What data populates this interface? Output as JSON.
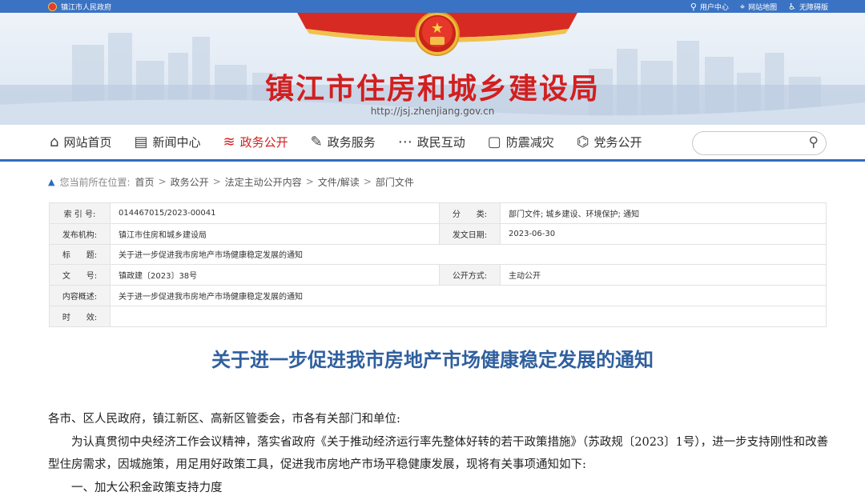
{
  "topbar": {
    "gov_name": "镇江市人民政府",
    "links": [
      "用户中心",
      "网站地图",
      "无障碍版"
    ]
  },
  "banner": {
    "title": "镇江市住房和城乡建设局",
    "url": "http://jsj.zhenjiang.gov.cn"
  },
  "nav": {
    "items": [
      {
        "label": "网站首页",
        "icon": "home-icon"
      },
      {
        "label": "新闻中心",
        "icon": "news-icon"
      },
      {
        "label": "政务公开",
        "icon": "layers-icon"
      },
      {
        "label": "政务服务",
        "icon": "document-icon"
      },
      {
        "label": "政民互动",
        "icon": "chat-icon"
      },
      {
        "label": "防震减灾",
        "icon": "square-icon"
      },
      {
        "label": "党务公开",
        "icon": "party-icon"
      }
    ],
    "active_index": 2,
    "search_placeholder": ""
  },
  "breadcrumb": {
    "label": "您当前所在位置:",
    "items": [
      "首页",
      "政务公开",
      "法定主动公开内容",
      "文件/解读",
      "部门文件"
    ]
  },
  "meta": {
    "index_label": "索 引 号:",
    "index_value": "014467015/2023-00041",
    "category_label": "分　　类:",
    "category_value": "部门文件;  城乡建设、环境保护;  通知",
    "org_label": "发布机构:",
    "org_value": "镇江市住房和城乡建设局",
    "date_label": "发文日期:",
    "date_value": "2023-06-30",
    "title_label": "标　　题:",
    "title_value": "关于进一步促进我市房地产市场健康稳定发展的通知",
    "docno_label": "文　　号:",
    "docno_value": "镇政建〔2023〕38号",
    "mode_label": "公开方式:",
    "mode_value": "主动公开",
    "summary_label": "内容概述:",
    "summary_value": "关于进一步促进我市房地产市场健康稳定发展的通知",
    "validity_label": "时　　效:",
    "validity_value": ""
  },
  "article": {
    "title": "关于进一步促进我市房地产市场健康稳定发展的通知",
    "salutation": "各市、区人民政府，镇江新区、高新区管委会，市各有关部门和单位:",
    "para1": "为认真贯彻中央经济工作会议精神，落实省政府《关于推动经济运行率先整体好转的若干政策措施》（苏政规〔2023〕1号），进一步支持刚性和改善型住房需求，因城施策，用足用好政策工具，促进我市房地产市场平稳健康发展，现将有关事项通知如下:",
    "heading1": "一、加大公积金政策支持力度"
  },
  "colors": {
    "brand_red": "#d21f1f",
    "brand_blue": "#2f6cc0",
    "title_blue": "#2f5f9e"
  }
}
